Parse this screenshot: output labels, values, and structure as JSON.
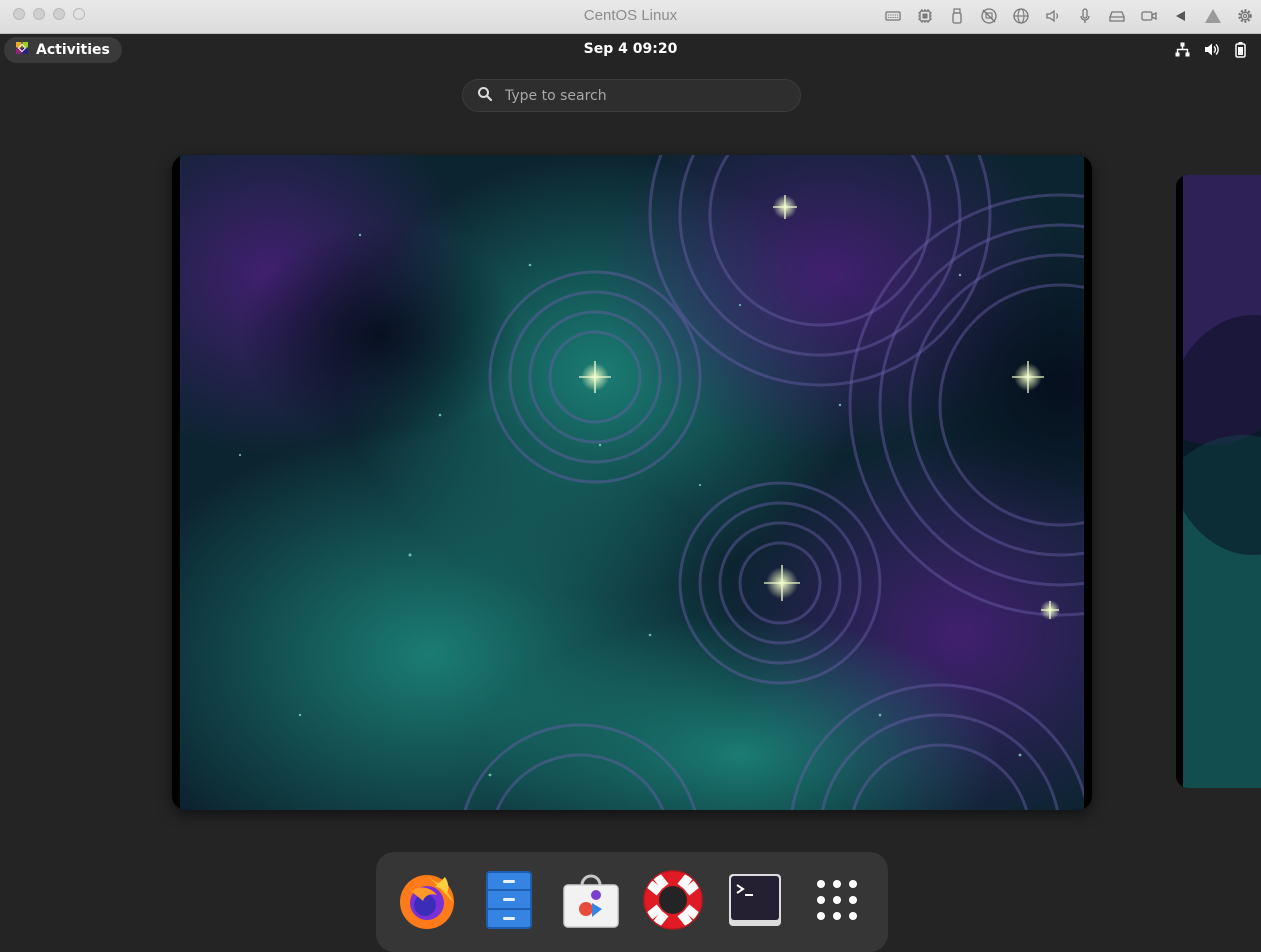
{
  "host_window": {
    "title": "CentOS Linux",
    "icons": [
      "keyboard-icon",
      "cpu-icon",
      "usb-icon",
      "display-off-icon",
      "globe-icon",
      "speaker-icon",
      "microphone-icon",
      "drive-icon",
      "camera-icon",
      "back-icon",
      "warning-icon",
      "gear-icon"
    ]
  },
  "top_bar": {
    "activities_label": "Activities",
    "clock": "Sep 4  09:20",
    "tray_icons": [
      "network-icon",
      "volume-icon",
      "battery-icon"
    ]
  },
  "search": {
    "placeholder": "Type to search",
    "value": ""
  },
  "dock": {
    "apps": [
      {
        "name": "Firefox",
        "icon": "firefox-icon"
      },
      {
        "name": "Files",
        "icon": "files-icon"
      },
      {
        "name": "Software",
        "icon": "software-icon"
      },
      {
        "name": "Help",
        "icon": "help-icon"
      },
      {
        "name": "Terminal",
        "icon": "terminal-icon"
      },
      {
        "name": "Show Applications",
        "icon": "app-grid-icon"
      }
    ]
  },
  "colors": {
    "background": "#242424",
    "dock": "#363636",
    "accent_teal": "#1f9a8a",
    "accent_purple": "#4a1f7a"
  }
}
